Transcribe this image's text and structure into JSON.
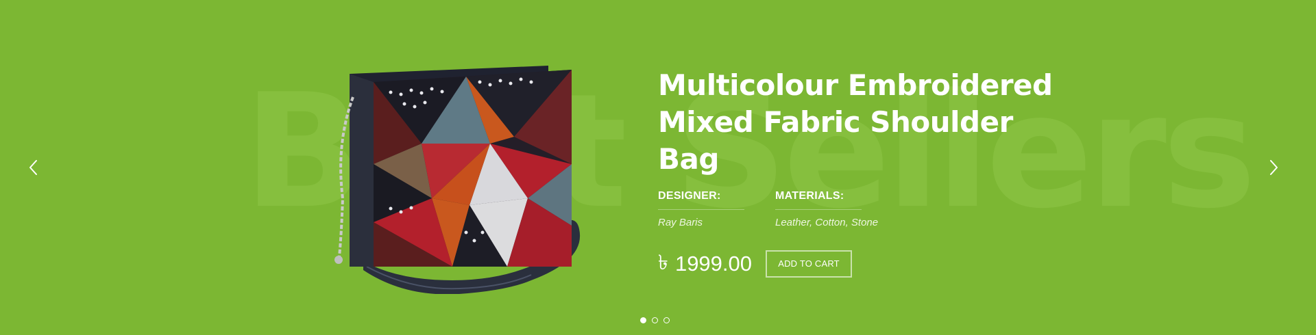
{
  "carousel": {
    "background_color": "#7cb733",
    "watermark_text": "Best Sellers",
    "prev_icon": "chevron-left-icon",
    "next_icon": "chevron-right-icon",
    "active_slide": 1,
    "slide_count": 3
  },
  "product": {
    "title": "Multicolour Embroidered Mixed Fabric Shoulder Bag",
    "image_description": "multicolour embroidered shoulder bag",
    "designer_label": "DESIGNER:",
    "designer": "Ray Baris",
    "materials_label": "MATERIALS:",
    "materials": "Leather, Cotton, Stone",
    "currency_symbol": "৳",
    "price": "1999.00",
    "add_to_cart_label": "ADD TO CART"
  }
}
